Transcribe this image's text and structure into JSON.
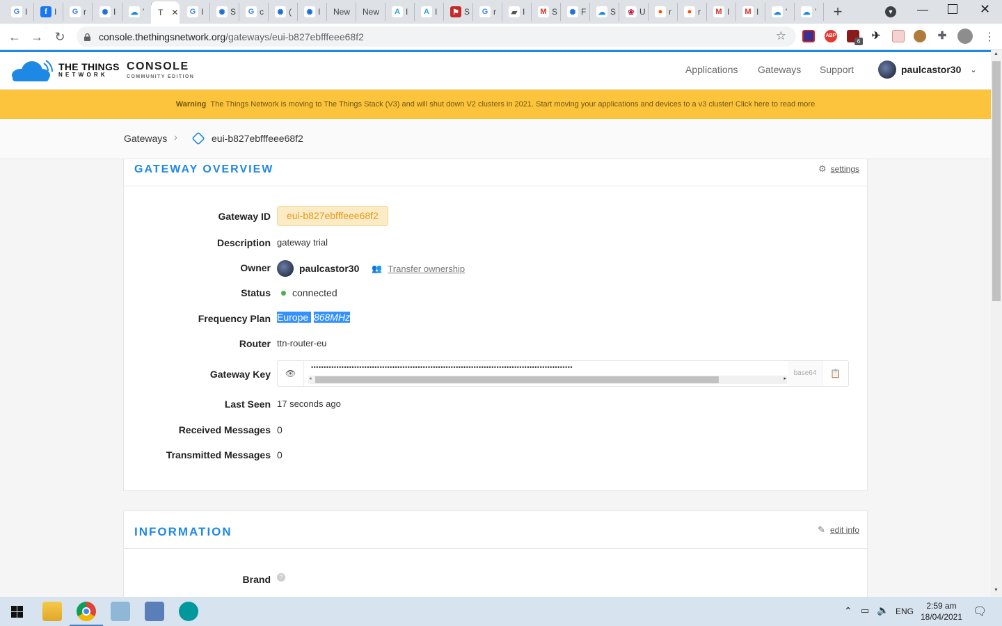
{
  "browser": {
    "tabs": [
      {
        "glyph": "G",
        "label": "I",
        "color": "#4285f4",
        "bg": "#fff"
      },
      {
        "glyph": "f",
        "label": "I",
        "color": "#fff",
        "bg": "#1877f2"
      },
      {
        "glyph": "G",
        "label": "r",
        "color": "#4285f4",
        "bg": "#fff"
      },
      {
        "glyph": "✺",
        "label": "I",
        "color": "#1e6fd9",
        "bg": "#fff"
      },
      {
        "glyph": "☁",
        "label": "'",
        "color": "#1e88e5",
        "bg": "#fff"
      },
      {
        "glyph": "G",
        "label": "I",
        "color": "#4285f4",
        "bg": "#fff"
      },
      {
        "glyph": "✺",
        "label": "S",
        "color": "#1e6fd9",
        "bg": "#fff"
      },
      {
        "glyph": "G",
        "label": "c",
        "color": "#4285f4",
        "bg": "#fff"
      },
      {
        "glyph": "✺",
        "label": "(",
        "color": "#1e6fd9",
        "bg": "#fff"
      },
      {
        "glyph": "✺",
        "label": "I",
        "color": "#1e6fd9",
        "bg": "#fff"
      },
      {
        "glyph": "",
        "label": "New",
        "color": "#444",
        "bg": "transparent"
      },
      {
        "glyph": "",
        "label": "New",
        "color": "#444",
        "bg": "transparent"
      },
      {
        "glyph": "A",
        "label": "I",
        "color": "#2aa0d8",
        "bg": "#fff"
      },
      {
        "glyph": "A",
        "label": "I",
        "color": "#2aa0d8",
        "bg": "#fff"
      },
      {
        "glyph": "⚑",
        "label": "S",
        "color": "#fff",
        "bg": "#c62828"
      },
      {
        "glyph": "G",
        "label": "r",
        "color": "#4285f4",
        "bg": "#fff"
      },
      {
        "glyph": "▰",
        "label": "I",
        "color": "#555",
        "bg": "#fff"
      },
      {
        "glyph": "M",
        "label": "S",
        "color": "#d93025",
        "bg": "#fff"
      },
      {
        "glyph": "✺",
        "label": "F",
        "color": "#1e6fd9",
        "bg": "#fff"
      },
      {
        "glyph": "☁",
        "label": "S",
        "color": "#1e88e5",
        "bg": "#fff"
      },
      {
        "glyph": "❀",
        "label": "U",
        "color": "#c51a4a",
        "bg": "#fff"
      },
      {
        "glyph": "●",
        "label": "r",
        "color": "#ff4500",
        "bg": "#fff"
      },
      {
        "glyph": "●",
        "label": "r",
        "color": "#ff4500",
        "bg": "#fff"
      },
      {
        "glyph": "M",
        "label": "I",
        "color": "#d93025",
        "bg": "#fff"
      },
      {
        "glyph": "M",
        "label": "I",
        "color": "#d93025",
        "bg": "#fff"
      },
      {
        "glyph": "☁",
        "label": "'",
        "color": "#1e88e5",
        "bg": "#fff"
      },
      {
        "glyph": "☁",
        "label": "'",
        "color": "#1e88e5",
        "bg": "#fff"
      }
    ],
    "active_tab_label": "T",
    "new_tab": "+",
    "url_host": "console.thethingsnetwork.org",
    "url_path": "/gateways/eui-b827ebfffeee68f2",
    "ext_abp": "ABP",
    "ext_badge": "6"
  },
  "header": {
    "logo_line1": "THE THINGS",
    "logo_line2": "N E T W O R K",
    "console": "CONSOLE",
    "edition": "COMMUNITY EDITION",
    "nav": [
      "Applications",
      "Gateways",
      "Support"
    ],
    "user": "paulcastor30"
  },
  "warning": {
    "label": "Warning",
    "text": "The Things Network is moving to The Things Stack (V3) and will shut down V2 clusters in 2021. Start moving your applications and devices to a v3 cluster! Click here to read more"
  },
  "breadcrumb": {
    "root": "Gateways",
    "current": "eui-b827ebfffeee68f2"
  },
  "overview": {
    "title": "GATEWAY OVERVIEW",
    "settings": "settings",
    "gateway_id_label": "Gateway ID",
    "gateway_id": "eui-b827ebfffeee68f2",
    "description_label": "Description",
    "description": "gateway trial",
    "owner_label": "Owner",
    "owner": "paulcastor30",
    "transfer": "Transfer ownership",
    "status_label": "Status",
    "status": "connected",
    "status_color": "#4caf50",
    "freq_label": "Frequency Plan",
    "freq_region": "Europe",
    "freq_band": "868MHz",
    "router_label": "Router",
    "router": "ttn-router-eu",
    "key_label": "Gateway Key",
    "key_masked": "•••••••••••••••••••••••••••••••••••••••••••••••••••••••••••••••••••••••••••••••••••••••••••••••••••••••",
    "key_format": "base64",
    "last_seen_label": "Last Seen",
    "last_seen": "17 seconds ago",
    "rx_label": "Received Messages",
    "rx": "0",
    "tx_label": "Transmitted Messages",
    "tx": "0"
  },
  "information": {
    "title": "INFORMATION",
    "edit": "edit info",
    "brand_label": "Brand"
  },
  "taskbar": {
    "lang": "ENG",
    "time": "2:59 am",
    "date": "18/04/2021"
  },
  "colors": {
    "accent": "#1e88e5",
    "warning_bg": "#fcc33c",
    "id_badge_bg": "#fdebc5",
    "id_badge_fg": "#e29a1a",
    "selection": "#3390ff"
  }
}
